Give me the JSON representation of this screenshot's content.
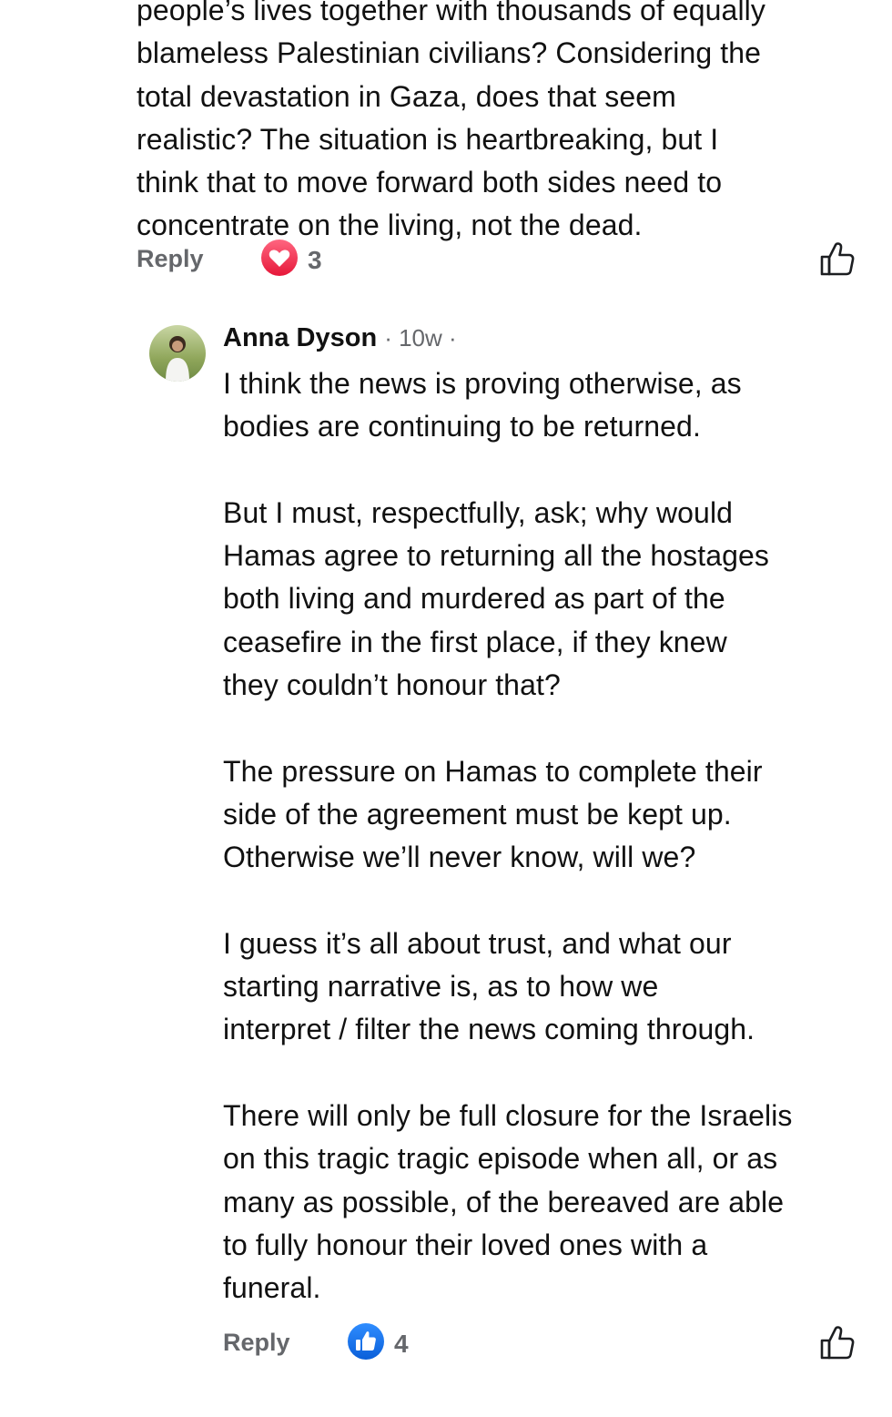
{
  "parent_comment": {
    "text": "people’s lives together with thousands of equally\nblameless Palestinian civilians?  Considering the\ntotal devastation in Gaza, does that seem\nrealistic?  The situation is heartbreaking, but I\nthink that to move forward both sides need to\nconcentrate on the living, not the dead.",
    "reply_label": "Reply",
    "reaction": {
      "type": "heart-icon",
      "count": "3",
      "color": "#f33e58"
    }
  },
  "reply_comment": {
    "author": "Anna Dyson",
    "timestamp": "· 10w ·",
    "text": "I think the news is proving otherwise, as\nbodies are continuing to be returned.\n\nBut I must, respectfully, ask; why would\nHamas agree to returning all the hostages\nboth living and murdered as part of the\nceasefire in the first place, if they knew\nthey couldn’t honour that?\n\nThe pressure on Hamas to complete their\nside of the agreement must be kept up.\nOtherwise we’ll never know, will we?\n\nI guess it’s all about trust, and what our\nstarting narrative is, as to how we\ninterpret / filter the news coming through.\n\nThere will only be full closure for the Israelis\non this tragic tragic episode when all, or as\nmany as possible, of the bereaved  are able\nto fully honour their loved ones with a\nfuneral.",
    "reply_label": "Reply",
    "reaction": {
      "type": "thumbs-up-icon",
      "count": "4",
      "color": "#1877f2"
    }
  },
  "colors": {
    "muted_text": "#65676b",
    "body_text": "#111111"
  }
}
